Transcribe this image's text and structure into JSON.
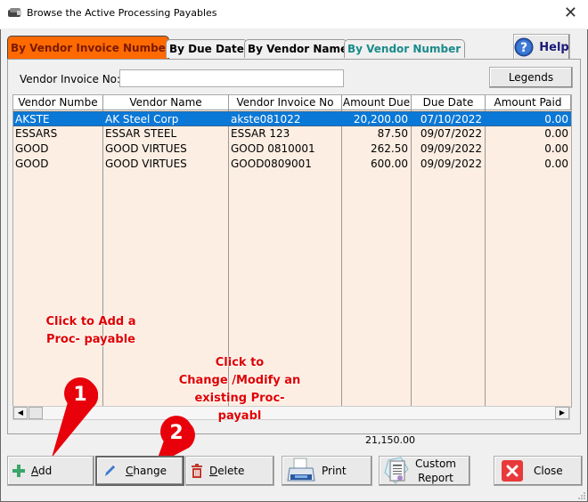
{
  "window": {
    "title": "Browse the Active Processing Payables",
    "close_glyph": "✕"
  },
  "tabs": [
    {
      "label": "By Vendor Invoice Number",
      "active": true
    },
    {
      "label": "By Due Date",
      "active": false
    },
    {
      "label": "By Vendor Name",
      "active": false
    },
    {
      "label": "By Vendor Number",
      "active": false
    }
  ],
  "toolbar": {
    "help_label": "Help",
    "legends_label": "Legends"
  },
  "search": {
    "label": "Vendor Invoice No:",
    "value": "",
    "placeholder": ""
  },
  "grid": {
    "columns": [
      "Vendor Numbe",
      "Vendor Name",
      "Vendor Invoice No",
      "Amount Due",
      "Due Date",
      "Amount Paid"
    ],
    "rows": [
      {
        "vendor_number": "AKSTE",
        "vendor_name": "AK Steel Corp",
        "invoice_no": "akste081022",
        "amount_due": "20,200.00",
        "due_date": "07/10/2022",
        "amount_paid": "0.00",
        "selected": true
      },
      {
        "vendor_number": "ESSARS",
        "vendor_name": "ESSAR STEEL",
        "invoice_no": "ESSAR 123",
        "amount_due": "87.50",
        "due_date": "09/07/2022",
        "amount_paid": "0.00",
        "selected": false
      },
      {
        "vendor_number": "GOOD",
        "vendor_name": "GOOD VIRTUES",
        "invoice_no": "GOOD 0810001",
        "amount_due": "262.50",
        "due_date": "09/09/2022",
        "amount_paid": "0.00",
        "selected": false
      },
      {
        "vendor_number": "GOOD",
        "vendor_name": "GOOD VIRTUES",
        "invoice_no": "GOOD0809001",
        "amount_due": "600.00",
        "due_date": "09/09/2022",
        "amount_paid": "0.00",
        "selected": false
      }
    ]
  },
  "total_amount_due": "21,150.00",
  "annotations": {
    "add_hint_line1": "Click to Add  a",
    "add_hint_line2": "Proc- payable",
    "change_hint_line1": "Click to",
    "change_hint_line2": "Change /Modify an",
    "change_hint_line3": "existing Proc-payabl",
    "pin1": "1",
    "pin2": "2"
  },
  "buttons": {
    "add": {
      "accel": "A",
      "rest": "dd"
    },
    "change": {
      "accel": "C",
      "rest": "hange"
    },
    "delete": {
      "accel": "D",
      "rest": "elete"
    },
    "print": "Print",
    "custom_report_line1": "Custom",
    "custom_report_line2": "Report",
    "close": "Close"
  },
  "colors": {
    "active_tab": "#ff6a00",
    "grid_bg": "#fdeee3",
    "selection": "#0a78d7",
    "annotation": "#e00000",
    "teal_tab": "#1a8a8a"
  }
}
